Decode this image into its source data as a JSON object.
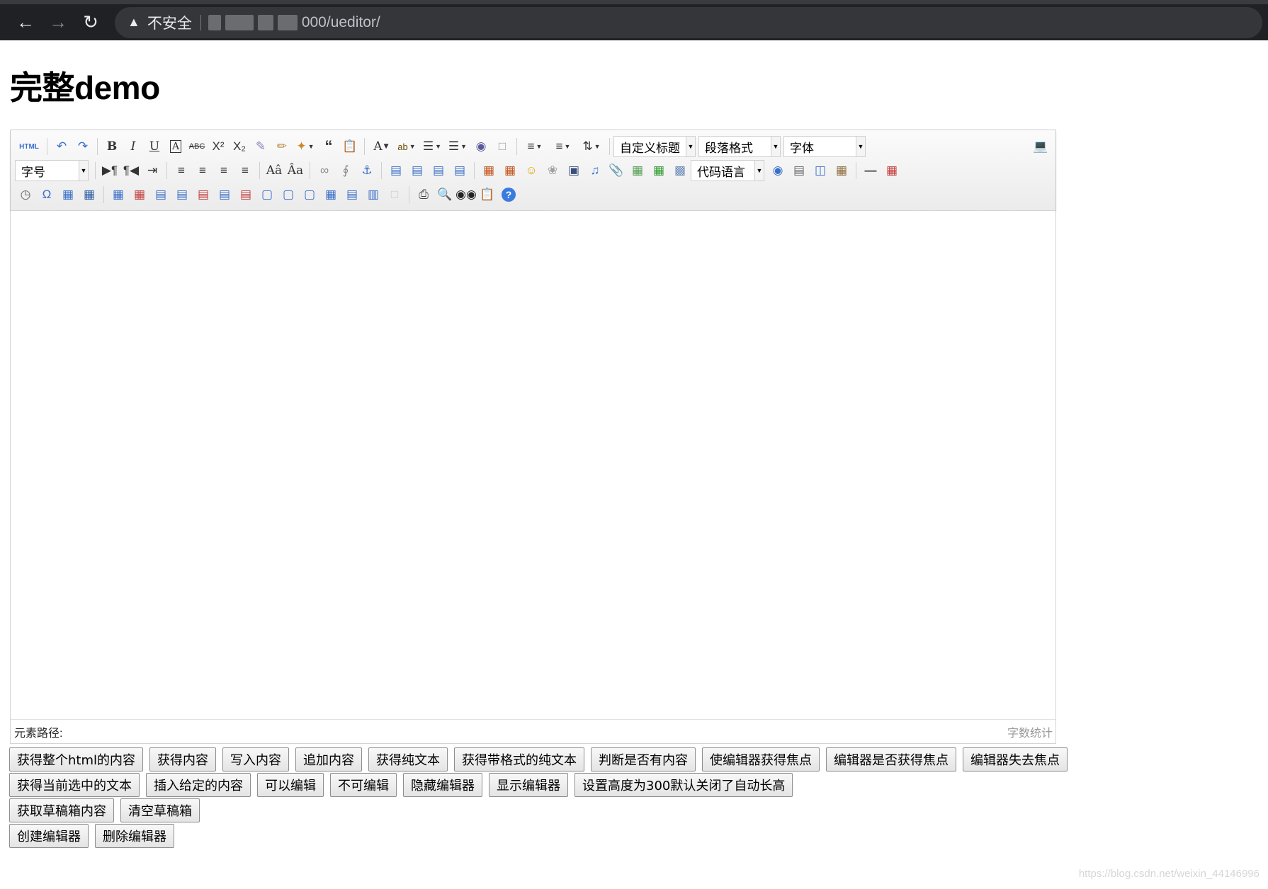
{
  "browser": {
    "security_label": "不安全",
    "url_suffix": "000/ueditor/"
  },
  "page": {
    "title": "完整demo"
  },
  "toolbar": {
    "selects": {
      "custom_heading": "自定义标题",
      "paragraph_format": "段落格式",
      "font_family": "字体",
      "font_size": "字号",
      "code_language": "代码语言"
    },
    "source_label": "HTML"
  },
  "status": {
    "element_path_label": "元素路径:",
    "word_count_label": "字数统计"
  },
  "buttons": {
    "row1": [
      "获得整个html的内容",
      "获得内容",
      "写入内容",
      "追加内容",
      "获得纯文本",
      "获得带格式的纯文本",
      "判断是否有内容",
      "使编辑器获得焦点",
      "编辑器是否获得焦点",
      "编辑器失去焦点"
    ],
    "row2": [
      "获得当前选中的文本",
      "插入给定的内容",
      "可以编辑",
      "不可编辑",
      "隐藏编辑器",
      "显示编辑器",
      "设置高度为300默认关闭了自动长高"
    ],
    "row3": [
      "获取草稿箱内容",
      "清空草稿箱"
    ],
    "row4": [
      "创建编辑器",
      "删除编辑器"
    ]
  },
  "watermark": "https://blog.csdn.net/weixin_44146996"
}
